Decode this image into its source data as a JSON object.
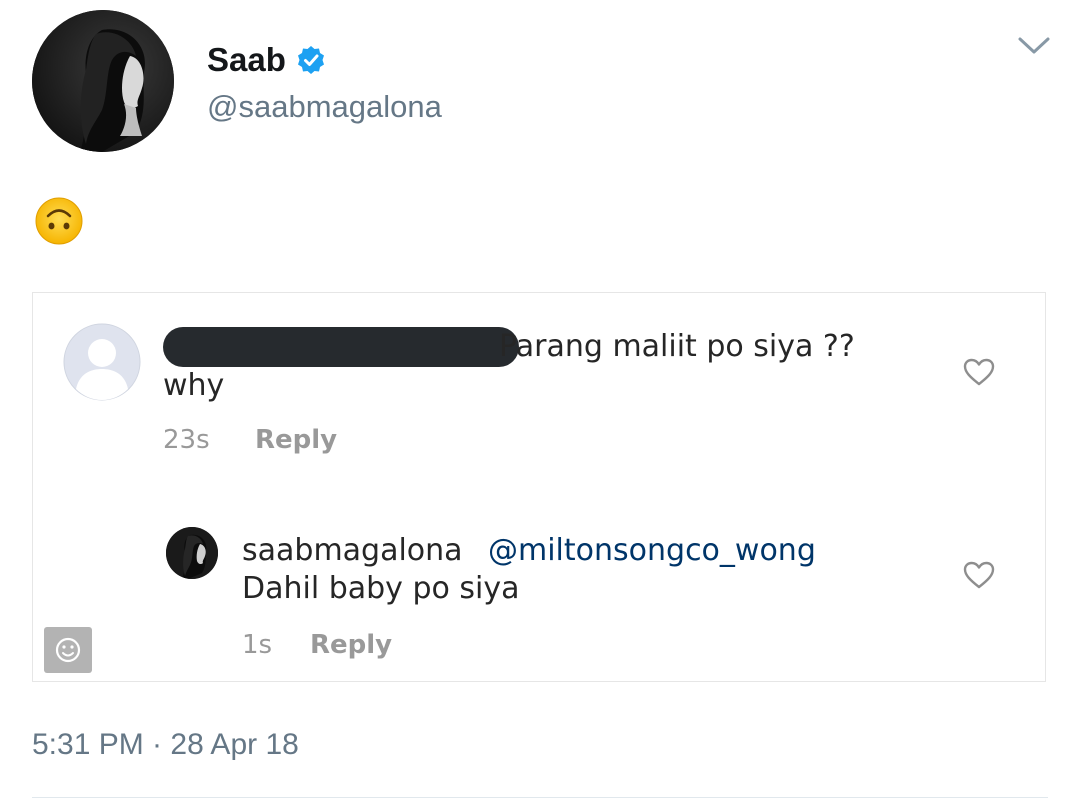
{
  "tweet": {
    "author": {
      "display_name": "Saab",
      "handle": "@saabmagalona",
      "verified": true,
      "verified_color": "#1da1f2"
    },
    "emoji_icon": "upside-down-face-icon",
    "timestamp": "5:31 PM · 28 Apr 18"
  },
  "instagram_screenshot": {
    "comments": [
      {
        "username_redacted": true,
        "text_line1": "Parang maliit po siya ??",
        "text_line2": "why",
        "time": "23s",
        "reply_label": "Reply"
      },
      {
        "username": "saabmagalona",
        "mention": "@miltonsongco_wong",
        "text": "Dahil baby po siya",
        "time": "1s",
        "reply_label": "Reply"
      }
    ],
    "colors": {
      "text": "#262626",
      "meta": "#999999",
      "mention": "#003569"
    }
  }
}
